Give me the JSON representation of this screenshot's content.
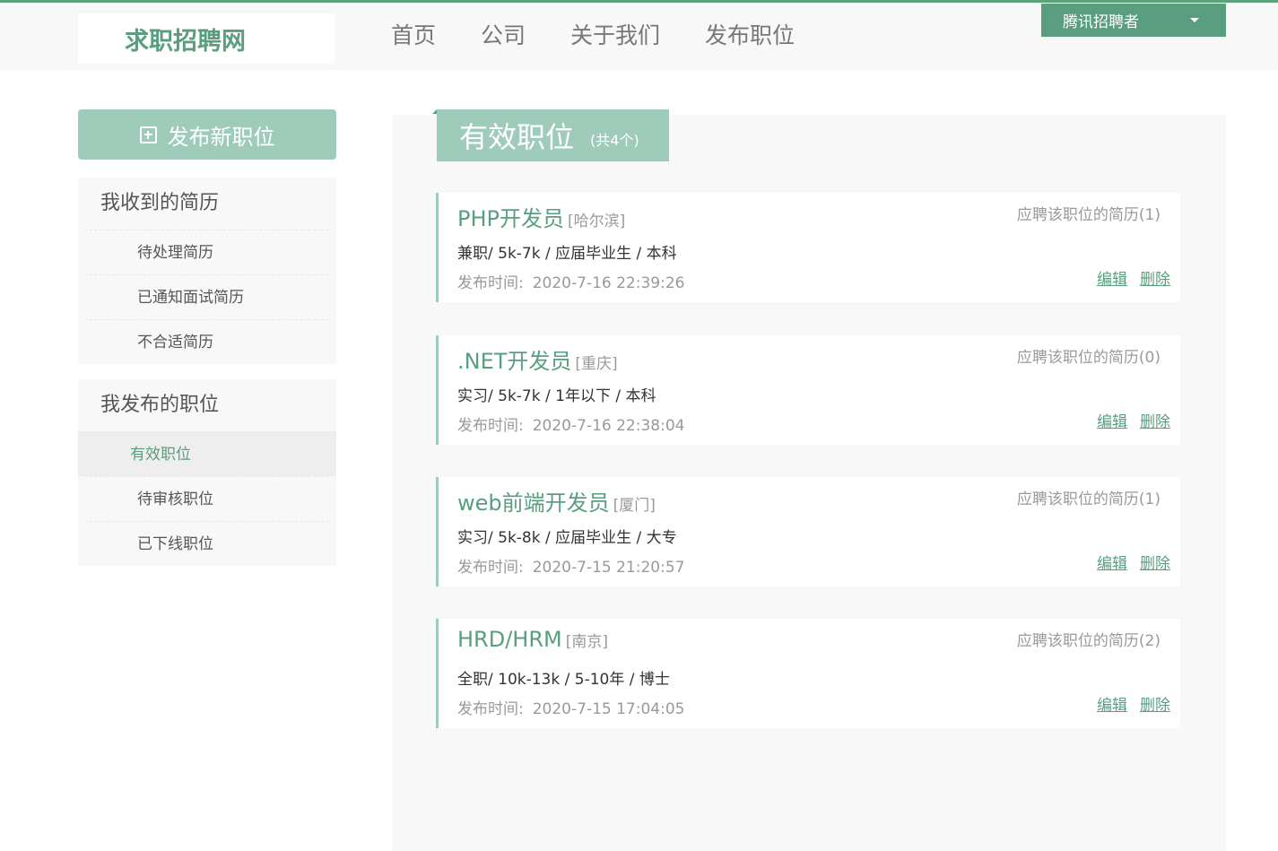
{
  "header": {
    "logo": "求职招聘网",
    "nav": [
      "首页",
      "公司",
      "关于我们",
      "发布职位"
    ],
    "user_menu": "腾讯招聘者"
  },
  "sidebar": {
    "publish_button": "发布新职位",
    "resume_group": {
      "title": "我收到的简历",
      "items": [
        "待处理简历",
        "已通知面试简历",
        "不合适简历"
      ]
    },
    "jobs_group": {
      "title": "我发布的职位",
      "items": [
        "有效职位",
        "待审核职位",
        "已下线职位"
      ],
      "active_index": 0
    }
  },
  "main": {
    "title": "有效职位",
    "count_text": "(共4个)",
    "time_label": "发布时间:",
    "resume_label": "应聘该职位的简历",
    "edit_label": "编辑",
    "delete_label": "删除",
    "jobs": [
      {
        "name": "PHP开发员",
        "city": "[哈尔滨]",
        "resume_count": "(1)",
        "meta": "兼职/ 5k-7k / 应届毕业生 / 本科",
        "time": "2020-7-16 22:39:26"
      },
      {
        "name": ".NET开发员",
        "city": "[重庆]",
        "resume_count": "(0)",
        "meta": "实习/ 5k-7k / 1年以下 / 本科",
        "time": "2020-7-16 22:38:04"
      },
      {
        "name": "web前端开发员",
        "city": "[厦门]",
        "resume_count": "(1)",
        "meta": "实习/ 5k-8k / 应届毕业生 / 大专",
        "time": "2020-7-15 21:20:57"
      },
      {
        "name": "HRD/HRM",
        "city": "[南京]",
        "resume_count": "(2)",
        "meta": "全职/ 10k-13k / 5-10年 / 博士",
        "time": "2020-7-15 17:04:05"
      }
    ]
  },
  "colors": {
    "accent": "#5a9e80",
    "accent_light": "#9fcbbb",
    "panel_bg": "#f8f8f8"
  }
}
